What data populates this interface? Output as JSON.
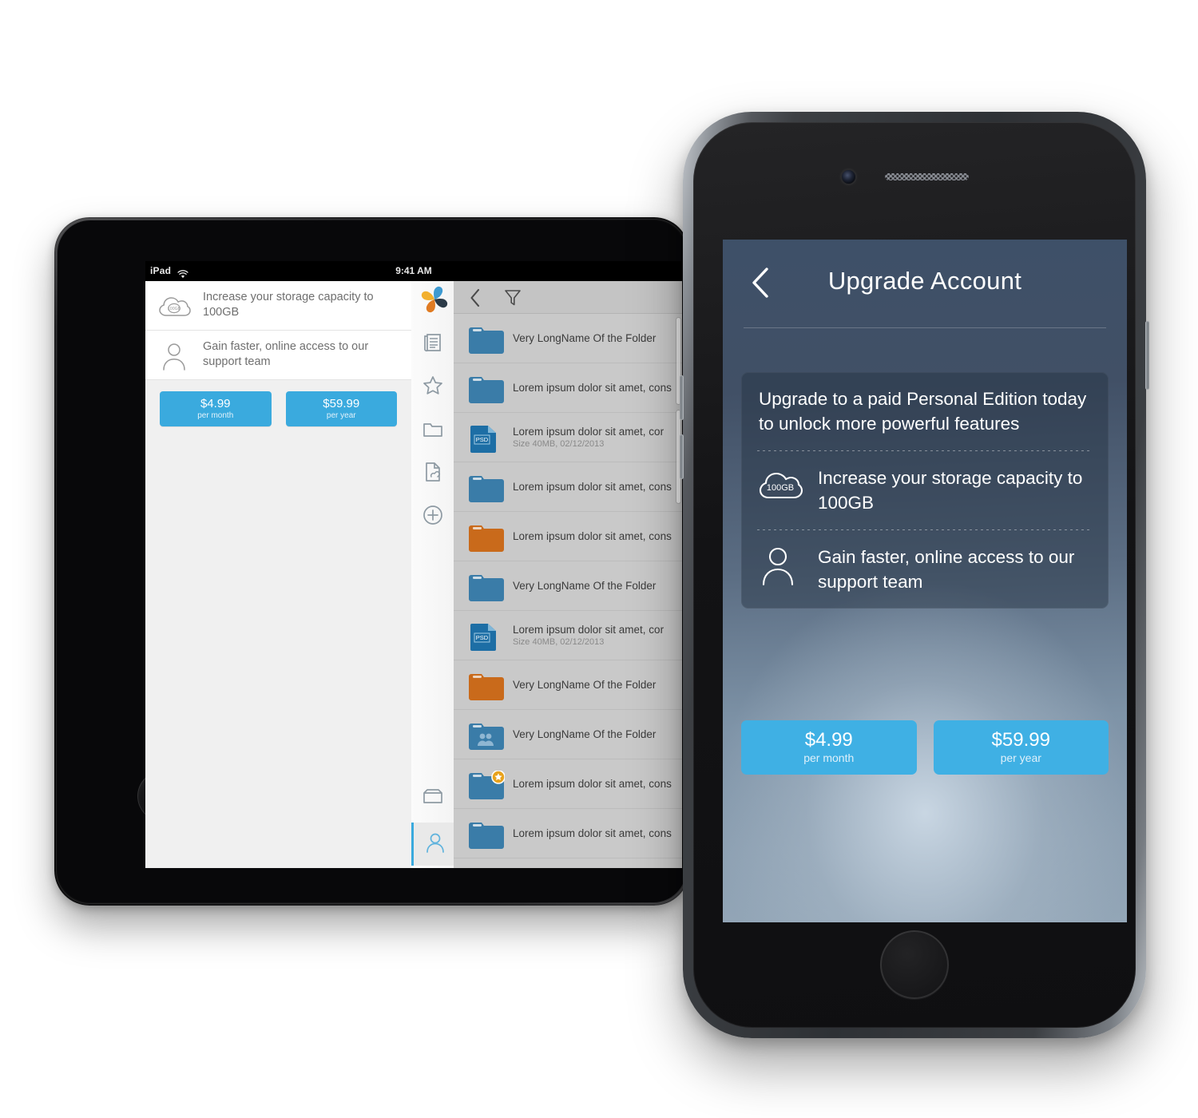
{
  "ipad": {
    "status": {
      "carrier": "iPad",
      "time": "9:41 AM",
      "wifi_icon": "wifi-icon"
    },
    "nav": {
      "back_icon": "chevron-left-icon",
      "title": "Upgrade Account"
    },
    "promo": "Upgrade to a paid Personal Edition today to unlock more powerful features",
    "features": [
      {
        "icon": "cloud-100gb-icon",
        "badge": "100GB",
        "text": "Increase your storage capacity to 100GB"
      },
      {
        "icon": "person-support-icon",
        "text": "Gain faster, online access to our support team"
      }
    ],
    "prices": [
      {
        "amount": "$4.99",
        "period": "per month"
      },
      {
        "amount": "$59.99",
        "period": "per year"
      }
    ],
    "rail": {
      "logo": "app-logo-pinwheel",
      "items": [
        {
          "icon": "news-document-icon",
          "selected": false
        },
        {
          "icon": "star-icon",
          "selected": false
        },
        {
          "icon": "folder-icon",
          "selected": false
        },
        {
          "icon": "document-link-icon",
          "selected": false
        },
        {
          "icon": "plus-circle-icon",
          "selected": false
        },
        {
          "icon": "inbox-tray-icon",
          "selected": false
        },
        {
          "icon": "person-icon",
          "selected": true
        }
      ]
    },
    "filebar": {
      "back_icon": "chevron-left-icon",
      "filter_icon": "funnel-filter-icon"
    },
    "files": [
      {
        "icon": "folder-blue",
        "name": "Very LongName Of the Folder",
        "meta": ""
      },
      {
        "icon": "folder-blue",
        "name": "Lorem ipsum dolor sit amet, cons",
        "meta": ""
      },
      {
        "icon": "file-psd",
        "name": "Lorem ipsum dolor sit amet, cor",
        "meta": "Size 40MB, 02/12/2013"
      },
      {
        "icon": "folder-blue",
        "name": "Lorem ipsum dolor sit amet, cons",
        "meta": ""
      },
      {
        "icon": "folder-orange",
        "name": "Lorem ipsum dolor sit amet, cons",
        "meta": ""
      },
      {
        "icon": "folder-blue",
        "name": "Very LongName Of the Folder",
        "meta": ""
      },
      {
        "icon": "file-psd",
        "name": "Lorem ipsum dolor sit amet, cor",
        "meta": "Size 40MB, 02/12/2013"
      },
      {
        "icon": "folder-orange",
        "name": "Very LongName Of the Folder",
        "meta": ""
      },
      {
        "icon": "folder-shared",
        "name": "Very LongName Of the Folder",
        "meta": ""
      },
      {
        "icon": "folder-starred",
        "name": "Lorem ipsum dolor sit amet, cons",
        "meta": ""
      },
      {
        "icon": "folder-blue",
        "name": "Lorem ipsum dolor sit amet, cons",
        "meta": ""
      }
    ]
  },
  "iphone": {
    "hardware": {
      "camera_icon": "front-camera-icon",
      "speaker_icon": "earpiece-speaker-icon",
      "home_icon": "home-button"
    },
    "nav": {
      "back_icon": "chevron-left-icon",
      "title": "Upgrade Account"
    },
    "promo": "Upgrade to a paid Personal Edition today to unlock more powerful features",
    "features": [
      {
        "icon": "cloud-100gb-icon",
        "badge": "100GB",
        "text": "Increase your storage capacity to 100GB"
      },
      {
        "icon": "person-support-icon",
        "text": "Gain faster, online access to our support team"
      }
    ],
    "prices": [
      {
        "amount": "$4.99",
        "period": "per month"
      },
      {
        "amount": "$59.99",
        "period": "per year"
      }
    ]
  },
  "colors": {
    "accent_blue": "#3aaade",
    "accent_blue_phone": "#3fb0e4",
    "folder_blue": "#3a7ca8",
    "folder_orange": "#c96a1b",
    "psd_blue": "#1d6ea5",
    "nav_title_gray": "#adadad",
    "body_gray": "#6f6f6f"
  }
}
